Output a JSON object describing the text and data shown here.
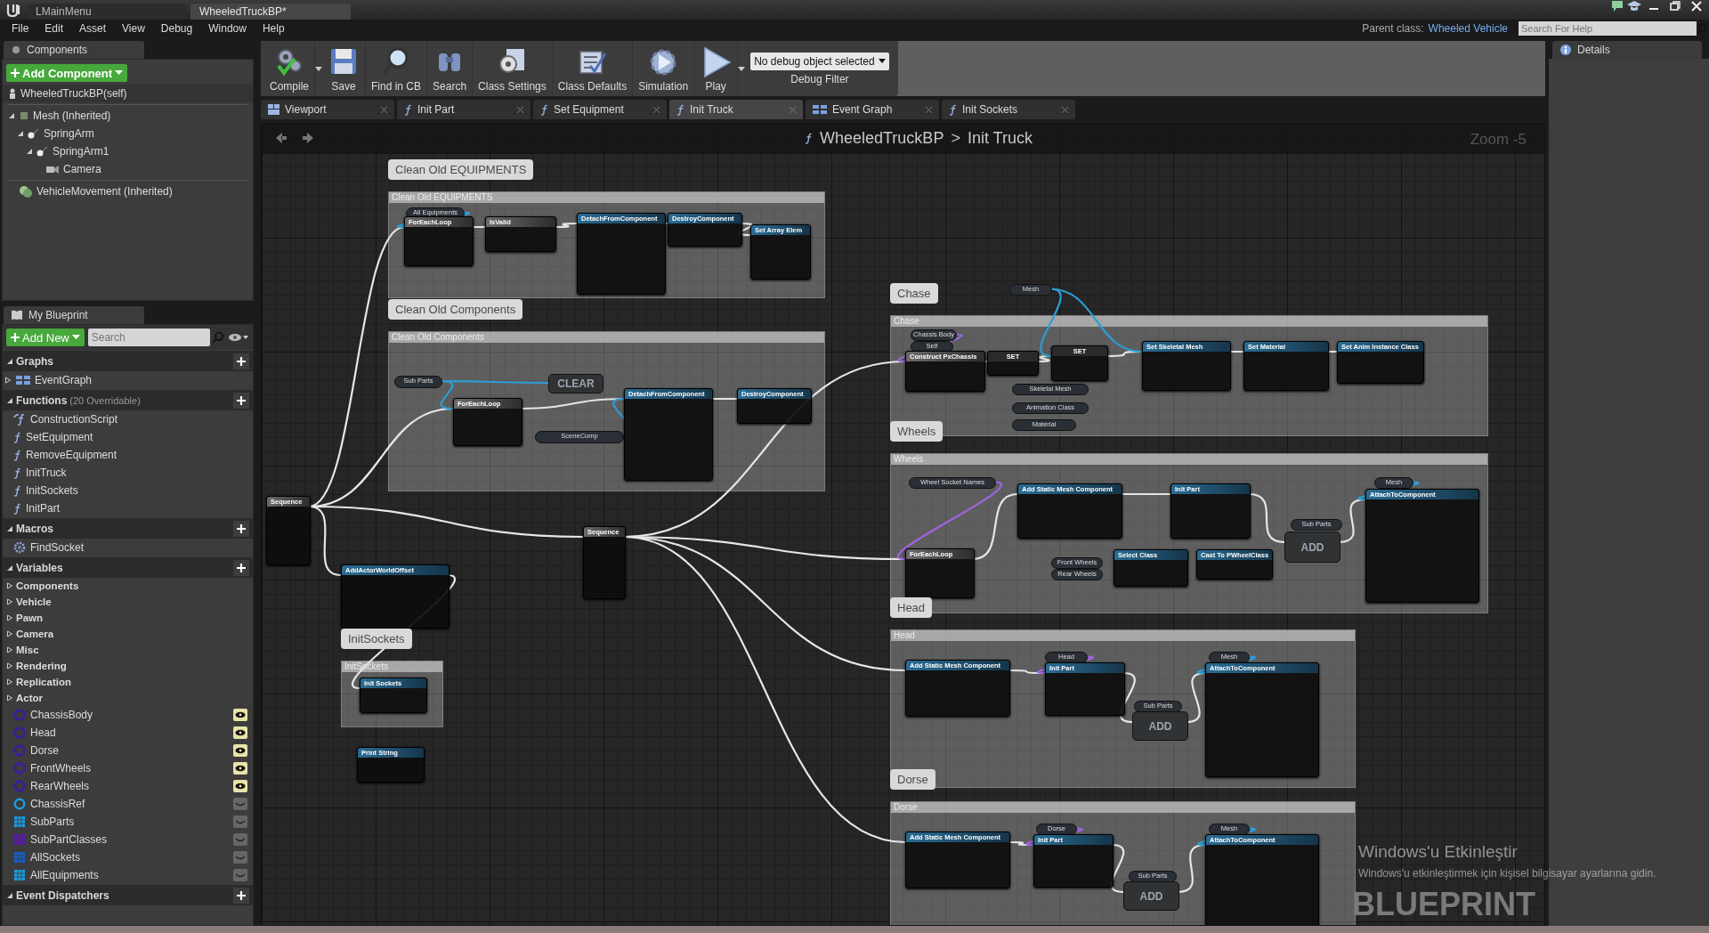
{
  "title_bar": {
    "tabs": [
      {
        "label": "LMainMenu",
        "selected": false
      },
      {
        "label": "WheeledTruckBP*",
        "selected": true
      }
    ]
  },
  "menu": [
    "File",
    "Edit",
    "Asset",
    "View",
    "Debug",
    "Window",
    "Help"
  ],
  "parent_class": {
    "label": "Parent class:",
    "value": "Wheeled Vehicle"
  },
  "help_search": {
    "placeholder": "Search For Help"
  },
  "components": {
    "tab": "Components",
    "add_button": "Add Component",
    "self_item": "WheeledTruckBP(self)",
    "tree": [
      {
        "label": "Mesh (Inherited)",
        "kind": "mesh",
        "expanded": true,
        "children": [
          {
            "label": "SpringArm",
            "kind": "spring_arm",
            "expanded": true,
            "children": [
              {
                "label": "SpringArm1",
                "kind": "spring_arm",
                "expanded": true,
                "children": [
                  {
                    "label": "Camera",
                    "kind": "camera"
                  }
                ]
              }
            ]
          }
        ]
      },
      {
        "label": "VehicleMovement (Inherited)",
        "kind": "movement"
      }
    ]
  },
  "my_blueprint": {
    "tab": "My Blueprint",
    "add_button": "Add New",
    "search_placeholder": "Search",
    "sections": [
      {
        "title": "Graphs",
        "expanded": true,
        "items": [
          {
            "label": "EventGraph",
            "kind": "graph",
            "expanded": false
          }
        ]
      },
      {
        "title": "Functions",
        "note": "(20 Overridable)",
        "expanded": true,
        "items": [
          {
            "label": "ConstructionScript",
            "kind": "construction"
          },
          {
            "label": "SetEquipment",
            "kind": "function"
          },
          {
            "label": "RemoveEquipment",
            "kind": "function"
          },
          {
            "label": "InitTruck",
            "kind": "function"
          },
          {
            "label": "InitSockets",
            "kind": "function"
          },
          {
            "label": "InitPart",
            "kind": "function"
          }
        ]
      },
      {
        "title": "Macros",
        "expanded": true,
        "items": [
          {
            "label": "FindSocket",
            "kind": "macro"
          }
        ]
      },
      {
        "title": "Variables",
        "expanded": true,
        "categories": [
          {
            "label": "Components",
            "expanded": false
          },
          {
            "label": "Vehicle",
            "expanded": false
          },
          {
            "label": "Pawn",
            "expanded": false
          },
          {
            "label": "Camera",
            "expanded": false
          },
          {
            "label": "Misc",
            "expanded": false
          },
          {
            "label": "Rendering",
            "expanded": false
          },
          {
            "label": "Replication",
            "expanded": false
          },
          {
            "label": "Actor",
            "expanded": false
          }
        ],
        "variables": [
          {
            "label": "ChassisBody",
            "kind": "object",
            "color": "#3d18a8",
            "exposed": true
          },
          {
            "label": "Head",
            "kind": "object",
            "color": "#3d18a8",
            "exposed": true
          },
          {
            "label": "Dorse",
            "kind": "object",
            "color": "#3d18a8",
            "exposed": true
          },
          {
            "label": "FrontWheels",
            "kind": "object",
            "color": "#3d18a8",
            "exposed": true
          },
          {
            "label": "RearWheels",
            "kind": "object",
            "color": "#3d18a8",
            "exposed": true
          },
          {
            "label": "ChassisRef",
            "kind": "object",
            "color": "#1a9ee0",
            "exposed": false
          },
          {
            "label": "SubParts",
            "kind": "array",
            "color": "#1a9ee0",
            "exposed": false
          },
          {
            "label": "SubPartClasses",
            "kind": "array",
            "color": "#5a17b5",
            "exposed": false
          },
          {
            "label": "AllSockets",
            "kind": "array",
            "color": "#1460d0",
            "exposed": false
          },
          {
            "label": "AllEquipments",
            "kind": "array",
            "color": "#1a9ee0",
            "exposed": false
          }
        ]
      },
      {
        "title": "Event Dispatchers",
        "expanded": true
      }
    ]
  },
  "toolbar": [
    {
      "label": "Compile",
      "kind": "compile",
      "has_menu": true
    },
    {
      "label": "Save",
      "kind": "save",
      "has_menu": false
    },
    {
      "label": "Find in CB",
      "kind": "find",
      "has_menu": false
    },
    {
      "label": "Search",
      "kind": "search",
      "has_menu": false
    },
    {
      "label": "Class Settings",
      "kind": "settings",
      "has_menu": false
    },
    {
      "label": "Class Defaults",
      "kind": "defaults",
      "has_menu": false
    },
    {
      "label": "Simulation",
      "kind": "simulation",
      "has_menu": false
    },
    {
      "label": "Play",
      "kind": "play",
      "has_menu": true
    }
  ],
  "debug": {
    "selected": "No debug object selected",
    "label": "Debug Filter"
  },
  "graph_tabs": [
    {
      "label": "Viewport",
      "kind": "viewport",
      "selected": false
    },
    {
      "label": "Init Part",
      "kind": "function",
      "selected": false
    },
    {
      "label": "Set Equipment",
      "kind": "function",
      "selected": false
    },
    {
      "label": "Init Truck",
      "kind": "function",
      "selected": true
    },
    {
      "label": "Event Graph",
      "kind": "graph",
      "selected": false
    },
    {
      "label": "Init Sockets",
      "kind": "function",
      "selected": false
    }
  ],
  "graph": {
    "owner": "WheeledTruckBP",
    "separator": ">",
    "function": "Init Truck",
    "zoom": "Zoom -5",
    "watermark": "BLUEPRINT",
    "comments": [
      {
        "bubble": "Clean Old EQUIPMENTS",
        "header": "Clean Old EQUIPMENTS"
      },
      {
        "bubble": "Clean Old Components",
        "header": "Clean Old Components"
      },
      {
        "bubble": "Chase",
        "header": "Chase"
      },
      {
        "bubble": "Wheels",
        "header": "Wheels"
      },
      {
        "bubble": "Head",
        "header": "Head"
      },
      {
        "bubble": "Dorse",
        "header": "Dorse"
      },
      {
        "bubble": "InitSockets",
        "header": "InitSockets"
      }
    ],
    "nodes": [
      {
        "title": "All Equipments",
        "kind": "variable"
      },
      {
        "title": "ForEachLoop",
        "kind": "macro"
      },
      {
        "title": "IsValid",
        "kind": "macro"
      },
      {
        "title": "DetachFromComponent",
        "kind": "function"
      },
      {
        "title": "DestroyComponent",
        "kind": "function"
      },
      {
        "title": "Set Array Elem",
        "kind": "function"
      },
      {
        "title": "Sub Parts",
        "kind": "variable"
      },
      {
        "title": "CLEAR",
        "kind": "compact"
      },
      {
        "title": "ForEachLoop",
        "kind": "macro"
      },
      {
        "title": "SceneComp",
        "kind": "variable"
      },
      {
        "title": "DetachFromComponent",
        "kind": "function"
      },
      {
        "title": "DestroyComponent",
        "kind": "function"
      },
      {
        "title": "Sequence",
        "kind": "macro"
      },
      {
        "title": "Sequence",
        "kind": "macro"
      },
      {
        "title": "AddActorWorldOffset",
        "kind": "function"
      },
      {
        "title": "Init Sockets",
        "kind": "function"
      },
      {
        "title": "Print String",
        "kind": "function"
      },
      {
        "title": "Mesh",
        "kind": "variable"
      },
      {
        "title": "Chassis Body",
        "kind": "variable"
      },
      {
        "title": "Self",
        "kind": "variable"
      },
      {
        "title": "Construct PxChassis",
        "kind": "macro"
      },
      {
        "title": "SET",
        "kind": "setter"
      },
      {
        "title": "SET",
        "kind": "setter"
      },
      {
        "title": "Set Skeletal Mesh",
        "kind": "function"
      },
      {
        "title": "Set Material",
        "kind": "function"
      },
      {
        "title": "Set Anim Instance Class",
        "kind": "function"
      },
      {
        "title": "Skeletal Mesh",
        "kind": "variable"
      },
      {
        "title": "Animation Class",
        "kind": "variable"
      },
      {
        "title": "Material",
        "kind": "variable"
      },
      {
        "title": "Wheel Socket Names",
        "kind": "variable"
      },
      {
        "title": "Add Static Mesh Component",
        "kind": "function"
      },
      {
        "title": "Init Part",
        "kind": "function"
      },
      {
        "title": "Sub Parts",
        "kind": "variable"
      },
      {
        "title": "ADD",
        "kind": "compact"
      },
      {
        "title": "Mesh",
        "kind": "variable"
      },
      {
        "title": "AttachToComponent",
        "kind": "function"
      },
      {
        "title": "ForEachLoop",
        "kind": "macro"
      },
      {
        "title": "Front Wheels",
        "kind": "variable"
      },
      {
        "title": "Rear Wheels",
        "kind": "variable"
      },
      {
        "title": "Select Class",
        "kind": "function"
      },
      {
        "title": "Cast To PWheelClass",
        "kind": "function"
      },
      {
        "title": "Head",
        "kind": "variable"
      },
      {
        "title": "Add Static Mesh Component",
        "kind": "function"
      },
      {
        "title": "Init Part",
        "kind": "function"
      },
      {
        "title": "Sub Parts",
        "kind": "variable"
      },
      {
        "title": "ADD",
        "kind": "compact"
      },
      {
        "title": "Mesh",
        "kind": "variable"
      },
      {
        "title": "AttachToComponent",
        "kind": "function"
      },
      {
        "title": "Dorse",
        "kind": "variable"
      },
      {
        "title": "Add Static Mesh Component",
        "kind": "function"
      },
      {
        "title": "Init Part",
        "kind": "function"
      },
      {
        "title": "Sub Parts",
        "kind": "variable"
      },
      {
        "title": "ADD",
        "kind": "compact"
      },
      {
        "title": "Mesh",
        "kind": "variable"
      },
      {
        "title": "AttachToComponent",
        "kind": "function"
      }
    ]
  },
  "details": {
    "tab": "Details"
  },
  "os_notice": {
    "title": "Windows'u Etkinleştir",
    "text": "Windows'u etkinleştirmek için kişisel bilgisayar ayarlarına gidin."
  }
}
